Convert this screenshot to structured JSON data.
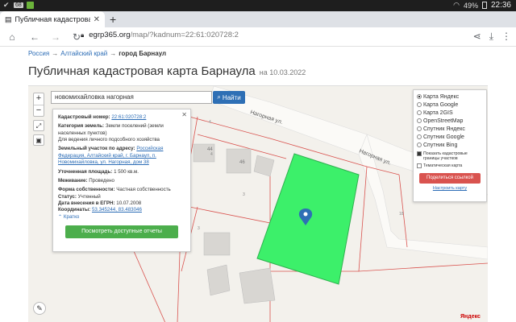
{
  "status_bar": {
    "battery": "49%",
    "time": "22:36",
    "badge": "68"
  },
  "tab": {
    "title": "Публичная кадастровая ка",
    "close": "✕"
  },
  "new_tab": "+",
  "toolbar": {
    "url_host": "egrp365.org",
    "url_path": "/map/?kadnum=22:61:020728:2"
  },
  "breadcrumb": {
    "items": [
      "Россия",
      "Алтайский край",
      "город Барнаул"
    ],
    "separator": "→"
  },
  "page": {
    "title": "Публичная кадастровая карта Барнаула",
    "date": "на 10.03.2022"
  },
  "map": {
    "zoom_in": "+",
    "zoom_out": "−",
    "search_value": "новомихайловка нагорная",
    "search_button": "Найти",
    "street_labels": [
      "Нагорная ул.",
      "Нагорная ул."
    ],
    "house_numbers": [
      "44",
      "46",
      "4",
      "4",
      "3",
      "3",
      "18"
    ],
    "parcel_color": "#3cf06a",
    "yandex": "Яндекс"
  },
  "info_card": {
    "close": "✕",
    "kadnum_label": "Кадастровый номер:",
    "kadnum_value": "22:61:020728:2",
    "category_label": "Категория земель:",
    "category_value": "Земли поселений (земли населенных пунктов)",
    "usage_value": "Для ведения личного подсобного хозяйства",
    "address_label": "Земельный участок по адресу:",
    "address_value": "Российская Федерация, Алтайский край, г. Барнаул, п. Новомихайловка, ул. Нагорная, дом 38",
    "area_label": "Уточненная площадь:",
    "area_value": "1 500 кв.м.",
    "survey_label": "Межевание:",
    "survey_value": "Проведено",
    "ownership_label": "Форма собственности:",
    "ownership_value": "Частная собственность",
    "status_label": "Статус:",
    "status_value": "Учтенный",
    "egrn_label": "Дата внесения в ЕГРН:",
    "egrn_value": "10.07.2008",
    "coords_label": "Координаты:",
    "coords_value": "53.345244, 83.483046",
    "short_link": "Кратко",
    "report_button": "Посмотреть доступные отчеты"
  },
  "layers": {
    "options": [
      {
        "label": "Карта Яндекс",
        "selected": true
      },
      {
        "label": "Карта Google",
        "selected": false
      },
      {
        "label": "Карта 2GIS",
        "selected": false
      },
      {
        "label": "OpenStreetMap",
        "selected": false
      },
      {
        "label": "Спутник Яндекс",
        "selected": false
      },
      {
        "label": "Спутник Google",
        "selected": false
      },
      {
        "label": "Спутник Bing",
        "selected": false
      }
    ],
    "show_borders": "Показать кадастровые границы участков",
    "thematic": "Тематическая карта",
    "share_button": "Поделиться ссылкой",
    "setup_map": "Настроить карту"
  }
}
